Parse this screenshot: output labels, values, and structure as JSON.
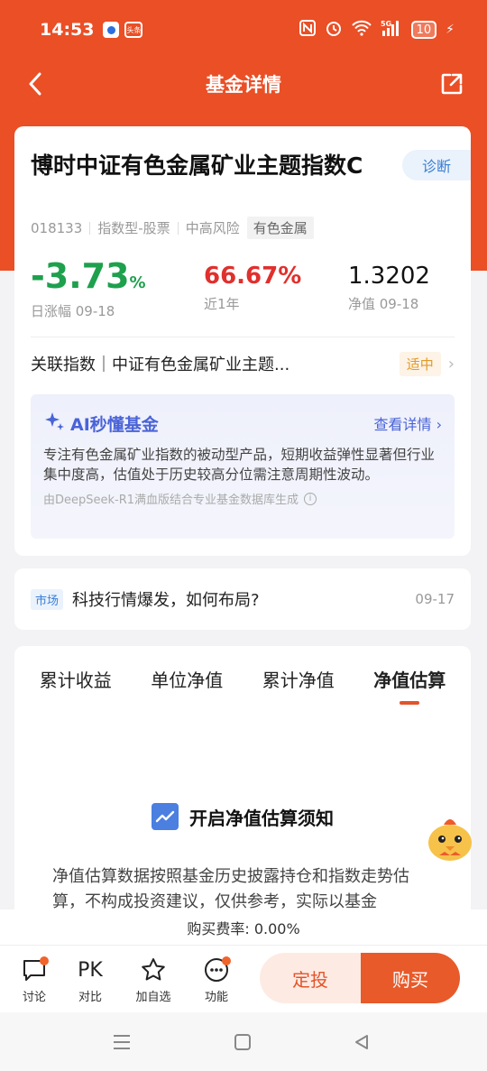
{
  "status": {
    "time": "14:53",
    "app2": "头条",
    "network": "5G",
    "battery": "10"
  },
  "header": {
    "title": "基金详情"
  },
  "fund": {
    "name": "博时中证有色金属矿业主题指数C",
    "diagnose": "诊断",
    "code": "018133",
    "type": "指数型-股票",
    "risk": "中高风险",
    "sector": "有色金属",
    "daily_change_value": "-3.73",
    "daily_change_unit": "%",
    "daily_change_label": "日涨幅 09-18",
    "year_return": "66.67%",
    "year_return_label": "近1年",
    "nav": "1.3202",
    "nav_label": "净值 09-18",
    "related_index": "关联指数｜中证有色金属矿业主题...",
    "index_badge": "适中"
  },
  "ai": {
    "title": "AI秒懂基金",
    "more": "查看详情",
    "body": "专注有色金属矿业指数的被动型产品，短期收益弹性显著但行业集中度高，估值处于历史较高分位需注意周期性波动。",
    "footer": "由DeepSeek-R1满血版结合专业基金数据库生成"
  },
  "news": {
    "tag": "市场",
    "text": "科技行情爆发，如何布局?",
    "date": "09-17"
  },
  "tabs": [
    "累计收益",
    "单位净值",
    "累计净值",
    "净值估算"
  ],
  "notice": {
    "title": "开启净值估算须知",
    "body": "净值估算数据按照基金历史披露持仓和指数走势估算，不构成投资建议，仅供参考，实际以基金"
  },
  "fee": "购买费率: 0.00%",
  "bottom": {
    "discuss": "讨论",
    "pk_icon": "PK",
    "compare": "对比",
    "watch": "加自选",
    "func": "功能",
    "dingtou": "定投",
    "buy": "购买"
  },
  "colors": {
    "brand": "#ea4f26",
    "down": "#1ea04d",
    "up": "#e0302d",
    "ai": "#4a63d7"
  }
}
